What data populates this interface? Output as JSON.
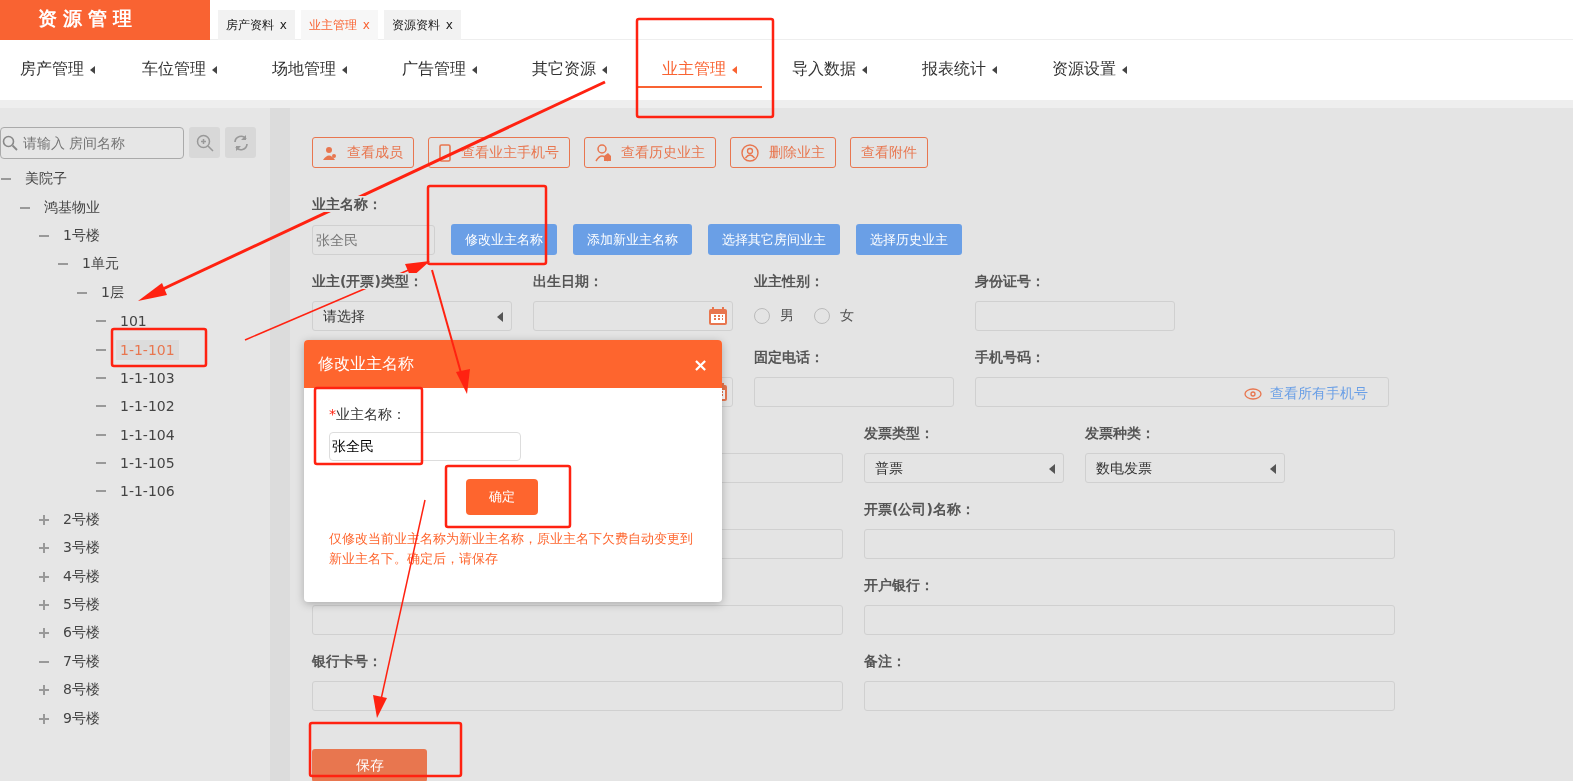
{
  "app": {
    "title": "资源管理"
  },
  "tabs": [
    {
      "label": "房产资料",
      "close": "x",
      "selected": false
    },
    {
      "label": "业主管理",
      "close": "x",
      "selected": true
    },
    {
      "label": "资源资料",
      "close": "x",
      "selected": false
    }
  ],
  "nav": [
    {
      "label": "房产管理",
      "selected": false
    },
    {
      "label": "车位管理",
      "selected": false
    },
    {
      "label": "场地管理",
      "selected": false
    },
    {
      "label": "广告管理",
      "selected": false
    },
    {
      "label": "其它资源",
      "selected": false
    },
    {
      "label": "业主管理",
      "selected": true
    },
    {
      "label": "导入数据",
      "selected": false
    },
    {
      "label": "报表统计",
      "selected": false
    },
    {
      "label": "资源设置",
      "selected": false
    }
  ],
  "sidebar": {
    "search": {
      "placeholder": "请输入 房间名称"
    },
    "tree": [
      {
        "label": "美院子",
        "expanded": true,
        "selected": false,
        "children": [
          {
            "label": "鸿基物业",
            "expanded": true,
            "selected": false,
            "children": [
              {
                "label": "1号楼",
                "expanded": true,
                "selected": false,
                "children": [
                  {
                    "label": "1单元",
                    "expanded": true,
                    "selected": false,
                    "children": [
                      {
                        "label": "1层",
                        "expanded": true,
                        "selected": false,
                        "children": [
                          {
                            "label": "101",
                            "expanded": true,
                            "selected": false
                          },
                          {
                            "label": "1-1-101",
                            "expanded": true,
                            "selected": true
                          },
                          {
                            "label": "1-1-103",
                            "expanded": true,
                            "selected": false
                          },
                          {
                            "label": "1-1-102",
                            "expanded": true,
                            "selected": false
                          },
                          {
                            "label": "1-1-104",
                            "expanded": true,
                            "selected": false
                          },
                          {
                            "label": "1-1-105",
                            "expanded": true,
                            "selected": false
                          },
                          {
                            "label": "1-1-106",
                            "expanded": true,
                            "selected": false
                          }
                        ]
                      }
                    ]
                  }
                ]
              },
              {
                "label": "2号楼",
                "expanded": false,
                "selected": false
              },
              {
                "label": "3号楼",
                "expanded": false,
                "selected": false
              },
              {
                "label": "4号楼",
                "expanded": false,
                "selected": false
              },
              {
                "label": "5号楼",
                "expanded": false,
                "selected": false
              },
              {
                "label": "6号楼",
                "expanded": false,
                "selected": false
              },
              {
                "label": "7号楼",
                "expanded": true,
                "selected": false
              },
              {
                "label": "8号楼",
                "expanded": false,
                "selected": false
              },
              {
                "label": "9号楼",
                "expanded": false,
                "selected": false
              }
            ]
          }
        ]
      }
    ]
  },
  "actions": [
    "查看成员",
    "查看业主手机号",
    "查看历史业主",
    "删除业主",
    "查看附件"
  ],
  "owner_name": {
    "label": "业主名称：",
    "value": "张全民",
    "buttons": [
      "修改业主名称",
      "添加新业主名称",
      "选择其它房间业主",
      "选择历史业主"
    ]
  },
  "form_rows": [
    [
      {
        "kind": "select",
        "label": "业主(开票)类型：",
        "value": "请选择"
      },
      {
        "kind": "date",
        "label": "出生日期："
      },
      {
        "kind": "radio",
        "label": "业主性别：",
        "options": [
          {
            "label": "男",
            "selected": false
          },
          {
            "label": "女",
            "selected": false
          }
        ]
      },
      {
        "kind": "text",
        "label": "身份证号："
      }
    ],
    [
      {
        "kind": "hidden"
      },
      {
        "kind": "date"
      },
      {
        "kind": "text",
        "label": "固定电话："
      },
      {
        "kind": "phone",
        "label": "手机号码：",
        "link": "查看所有手机号"
      }
    ],
    [
      {
        "kind": "stub"
      },
      {
        "kind": "select",
        "label": "发票类型：",
        "value": "普票"
      },
      {
        "kind": "select",
        "label": "发票种类：",
        "value": "数电发票"
      }
    ],
    [
      {
        "kind": "stub"
      },
      {
        "kind": "text",
        "label": "开票(公司)名称："
      }
    ],
    [
      {
        "kind": "text"
      },
      {
        "kind": "text",
        "label": "开户银行："
      }
    ],
    [
      {
        "kind": "text",
        "label": "银行卡号："
      },
      {
        "kind": "text",
        "label": "备注："
      }
    ]
  ],
  "save": "保存",
  "dialog": {
    "title": "修改业主名称",
    "close": "×",
    "required_mark": "*",
    "label": "业主名称：",
    "value": "张全民",
    "confirm": "确定",
    "note": "仅修改当前业主名称为新业主名称，原业主名下欠费自动变更到新业主名下。确定后，请保存"
  }
}
